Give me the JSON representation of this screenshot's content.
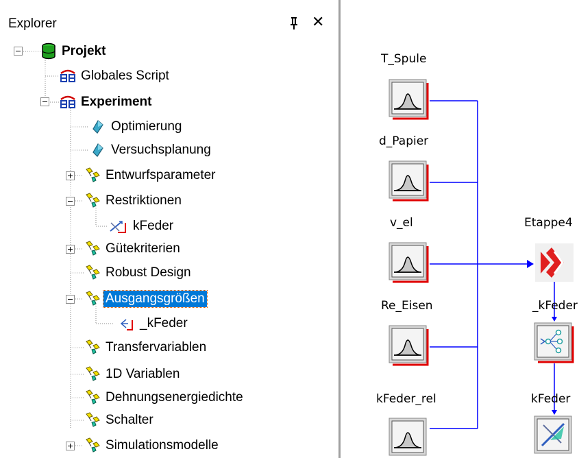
{
  "explorer": {
    "title": "Explorer",
    "pin_icon": "pushpin-icon",
    "close_label": "✕",
    "items": [
      {
        "label": "Projekt",
        "icon": "database-icon",
        "expander": "minus"
      },
      {
        "label": "Globales Script",
        "icon": "script-icon"
      },
      {
        "label": "Experiment",
        "icon": "script-icon",
        "expander": "minus"
      },
      {
        "label": "Optimierung",
        "icon": "diamond-icon"
      },
      {
        "label": "Versuchsplanung",
        "icon": "diamond-icon"
      },
      {
        "label": "Entwurfsparameter",
        "icon": "variable-group-icon",
        "expander": "plus"
      },
      {
        "label": "Restriktionen",
        "icon": "variable-group-icon",
        "expander": "minus"
      },
      {
        "label": "kFeder",
        "icon": "restriction-icon"
      },
      {
        "label": "Gütekriterien",
        "icon": "variable-group-icon",
        "expander": "plus"
      },
      {
        "label": "Robust Design",
        "icon": "variable-group-icon"
      },
      {
        "label": "Ausgangsgrößen",
        "icon": "variable-group-icon",
        "expander": "minus",
        "selected": true
      },
      {
        "label": "_kFeder",
        "icon": "output-icon"
      },
      {
        "label": "Transfervariablen",
        "icon": "variable-group-icon"
      },
      {
        "label": "1D Variablen",
        "icon": "variable-group-icon"
      },
      {
        "label": "Dehnungsenergiedichte",
        "icon": "variable-group-icon"
      },
      {
        "label": "Schalter",
        "icon": "variable-group-icon"
      },
      {
        "label": "Simulationsmodelle",
        "icon": "variable-group-icon",
        "expander": "plus"
      }
    ]
  },
  "canvas": {
    "inputs": [
      "T_Spule",
      "d_Papier",
      "v_el",
      "Re_Eisen",
      "kFeder_rel"
    ],
    "stage_label": "Etappe4",
    "node_labels": [
      "_kFeder",
      "kFeder"
    ],
    "connector_color": "#0000ff",
    "node_accent_color": "#e00000"
  }
}
